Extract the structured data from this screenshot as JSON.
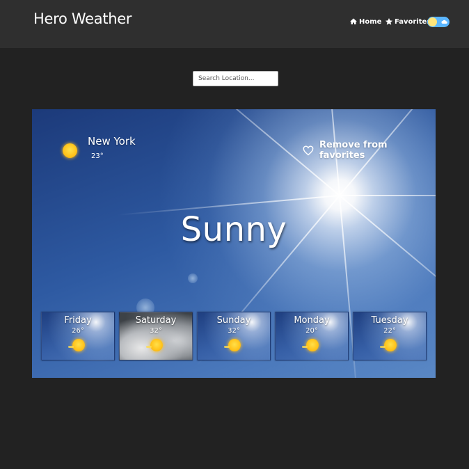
{
  "app": {
    "title": "Hero Weather"
  },
  "nav": {
    "home_label": "Home",
    "favorites_label": "Favorites",
    "home_icon": "home-icon",
    "favorites_icon": "star-icon"
  },
  "search": {
    "placeholder": "Search Location..."
  },
  "current": {
    "city": "New York",
    "temp": "23°",
    "condition": "Sunny",
    "icon": "sun-icon",
    "favorite_label": "Remove from favorites"
  },
  "forecast": [
    {
      "day": "Friday",
      "temp": "26°",
      "icon": "sun-icon"
    },
    {
      "day": "Saturday",
      "temp": "32°",
      "icon": "sun-icon"
    },
    {
      "day": "Sunday",
      "temp": "32°",
      "icon": "sun-icon"
    },
    {
      "day": "Monday",
      "temp": "20°",
      "icon": "sun-icon"
    },
    {
      "day": "Tuesday",
      "temp": "22°",
      "icon": "sun-icon"
    }
  ],
  "colors": {
    "page_bg": "#222222",
    "navbar_bg": "#2f2f2f",
    "toggle_bg": "#5bb6ff",
    "sun": "#ffc21a"
  }
}
